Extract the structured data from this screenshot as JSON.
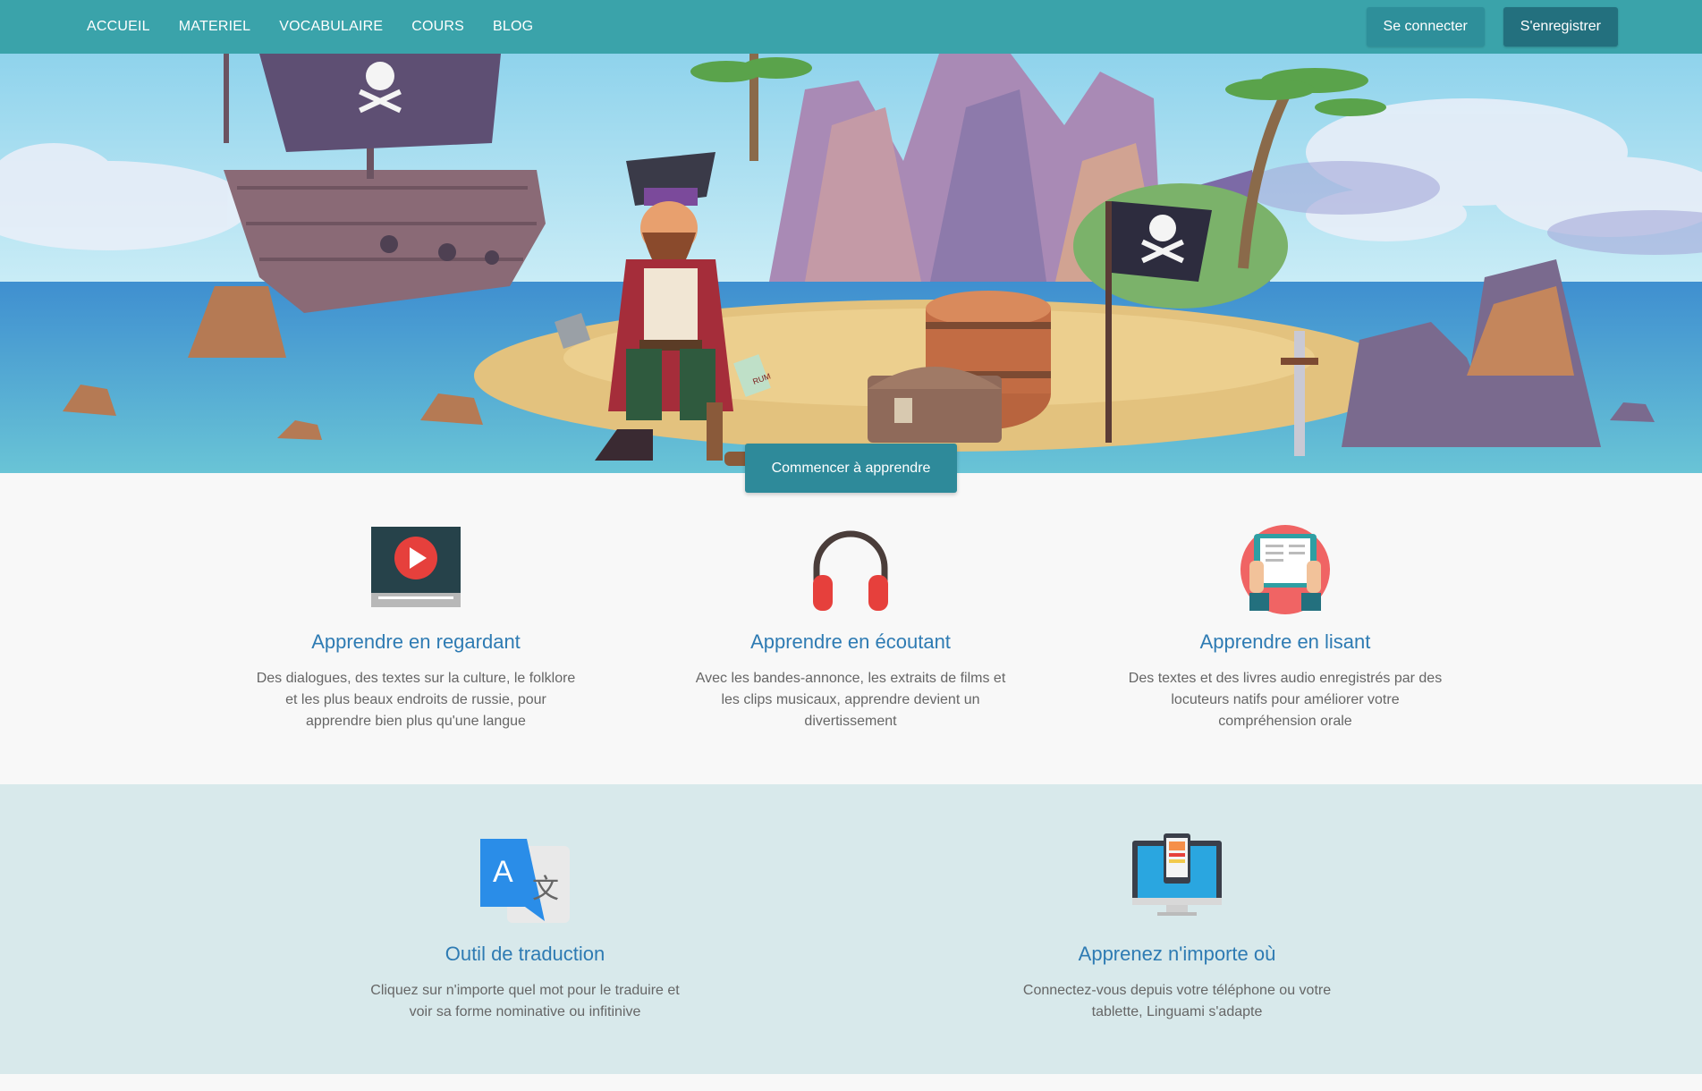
{
  "nav": {
    "links": [
      "ACCUEIL",
      "MATERIEL",
      "VOCABULAIRE",
      "COURS",
      "BLOG"
    ],
    "login": "Se connecter",
    "register": "S'enregistrer"
  },
  "hero": {
    "cta": "Commencer à apprendre",
    "flag_text": "RUM"
  },
  "features": [
    {
      "title": "Apprendre en regardant",
      "text": "Des dialogues, des textes sur la culture, le folklore et les plus beaux endroits de russie, pour apprendre bien plus qu'une langue",
      "icon": "video-play-icon"
    },
    {
      "title": "Apprendre en écoutant",
      "text": "Avec les bandes-annonce, les extraits de films et les clips musicaux, apprendre devient un divertissement",
      "icon": "headphones-icon"
    },
    {
      "title": "Apprendre en lisant",
      "text": "Des textes et des livres audio enregistrés par des locuteurs natifs pour améliorer votre compréhension orale",
      "icon": "book-reading-icon"
    }
  ],
  "features2": [
    {
      "title": "Outil de traduction",
      "text": "Cliquez sur n'importe quel mot pour le traduire et voir sa forme nominative ou infitinive",
      "icon": "translate-icon"
    },
    {
      "title": "Apprenez n'importe où",
      "text": "Connectez-vous depuis votre téléphone ou votre tablette, Linguami s'adapte",
      "icon": "devices-icon"
    }
  ],
  "colors": {
    "nav": "#3aa3aa",
    "accent": "#2e7bb3",
    "band": "#d8e9eb"
  }
}
